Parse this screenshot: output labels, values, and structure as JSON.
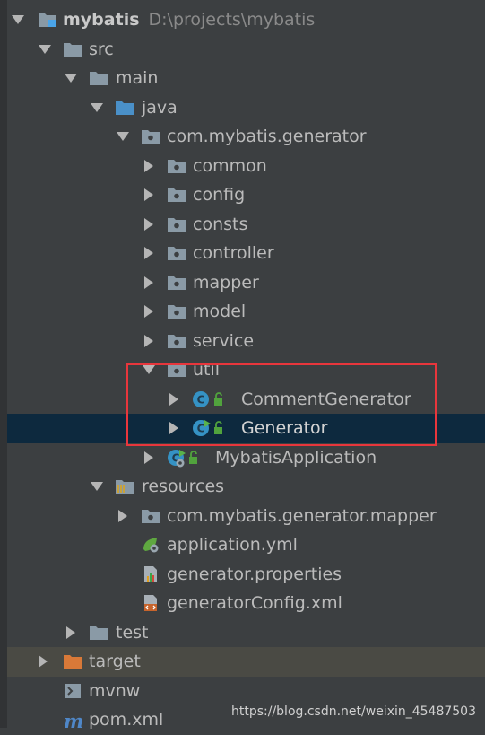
{
  "project": {
    "name": "mybatis",
    "path": "D:\\projects\\mybatis"
  },
  "items": [
    {
      "label": "src"
    },
    {
      "label": "main"
    },
    {
      "label": "java"
    },
    {
      "label": "com.mybatis.generator"
    },
    {
      "label": "common"
    },
    {
      "label": "config"
    },
    {
      "label": "consts"
    },
    {
      "label": "controller"
    },
    {
      "label": "mapper"
    },
    {
      "label": "model"
    },
    {
      "label": "service"
    },
    {
      "label": "util"
    },
    {
      "label": "CommentGenerator"
    },
    {
      "label": "Generator"
    },
    {
      "label": "MybatisApplication"
    },
    {
      "label": "resources"
    },
    {
      "label": "com.mybatis.generator.mapper"
    },
    {
      "label": "application.yml"
    },
    {
      "label": "generator.properties"
    },
    {
      "label": "generatorConfig.xml"
    },
    {
      "label": "test"
    },
    {
      "label": "target"
    },
    {
      "label": "mvnw"
    },
    {
      "label": "pom.xml"
    }
  ],
  "watermark": "https://blog.csdn.net/weixin_45487503",
  "colors": {
    "background": "#3c3f41",
    "selection": "#0d293e",
    "highlight_box": "#e8363c",
    "folder": "#8a9aa6",
    "target_folder": "#d97938",
    "class_icon": "#3592c4"
  }
}
